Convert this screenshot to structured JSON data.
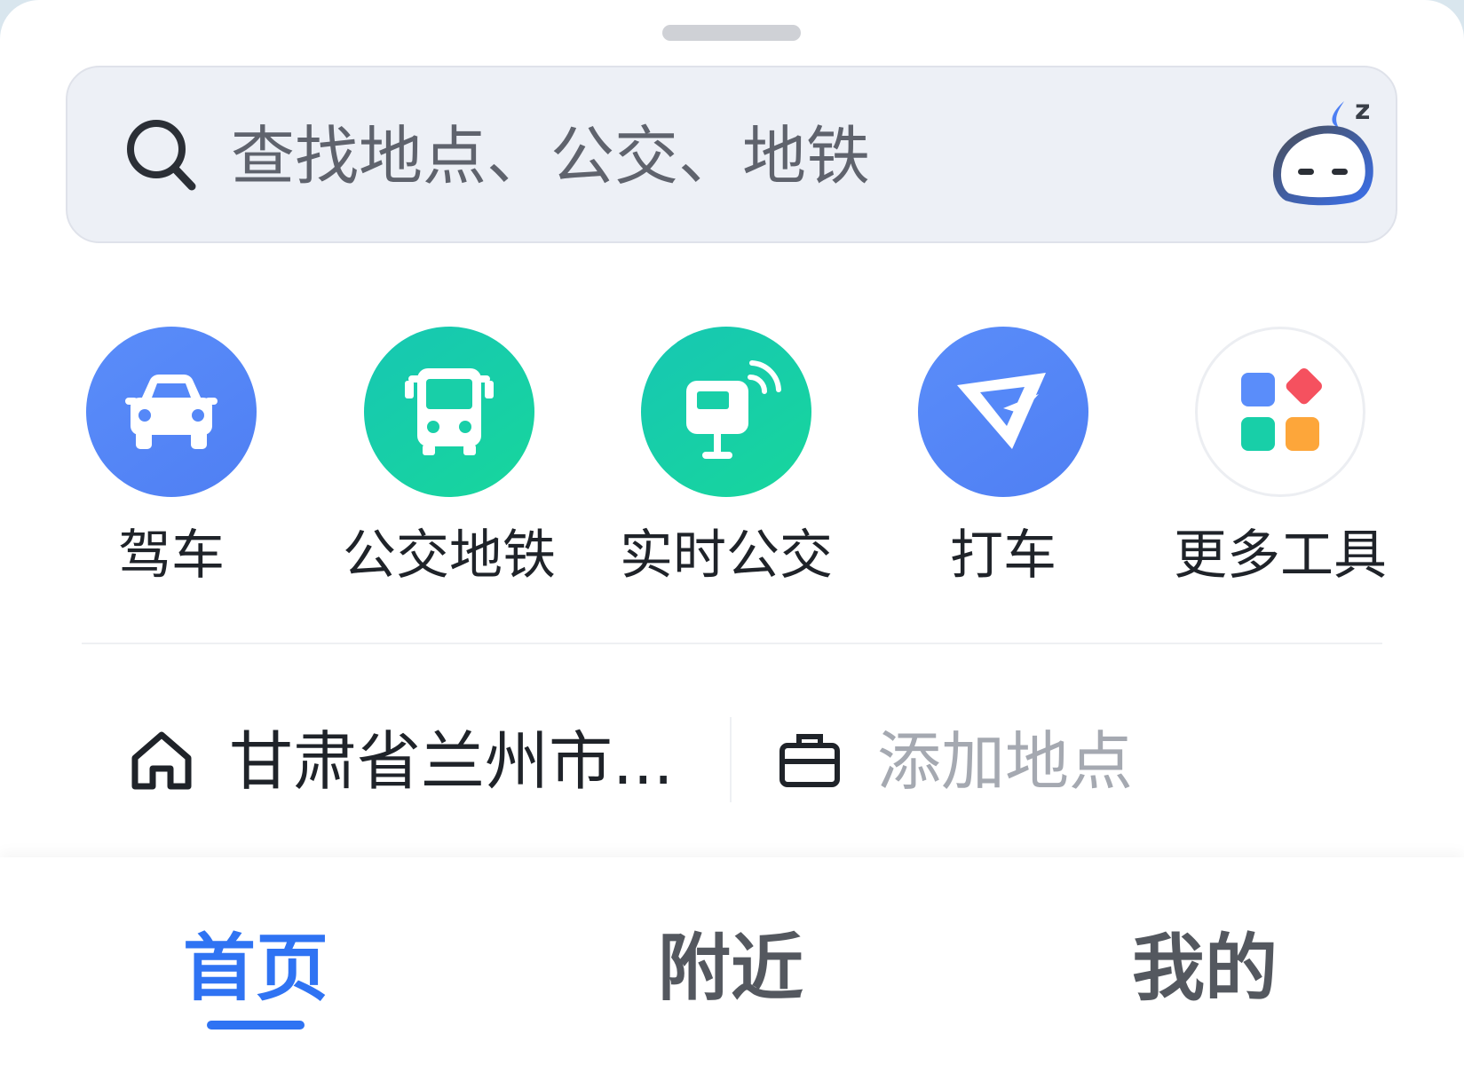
{
  "search": {
    "placeholder": "查找地点、公交、地铁",
    "left_icon": "search-icon",
    "right_icon": "assistant-sleeping-icon"
  },
  "tools": [
    {
      "label": "驾车",
      "icon": "car-icon",
      "color": "#5588f8"
    },
    {
      "label": "公交地铁",
      "icon": "bus-icon",
      "color": "#18cfa8"
    },
    {
      "label": "实时公交",
      "icon": "bus-stop-signal-icon",
      "color": "#18cfa8"
    },
    {
      "label": "打车",
      "icon": "ride-hailing-icon",
      "color": "#5588f8"
    },
    {
      "label": "更多工具",
      "icon": "apps-grid-icon",
      "color": "#ffffff"
    }
  ],
  "places": {
    "home": {
      "label": "甘肃省兰州市...",
      "icon": "home-icon"
    },
    "work": {
      "label": "添加地点",
      "icon": "briefcase-icon"
    }
  },
  "tabs": [
    {
      "label": "首页",
      "active": true
    },
    {
      "label": "附近",
      "active": false
    },
    {
      "label": "我的",
      "active": false
    }
  ],
  "colors": {
    "accent": "#2f73f3",
    "blue_tool": "#5588f8",
    "green_tool": "#18cfa8",
    "text_primary": "#1f2329",
    "text_placeholder": "#a5a9b1"
  }
}
